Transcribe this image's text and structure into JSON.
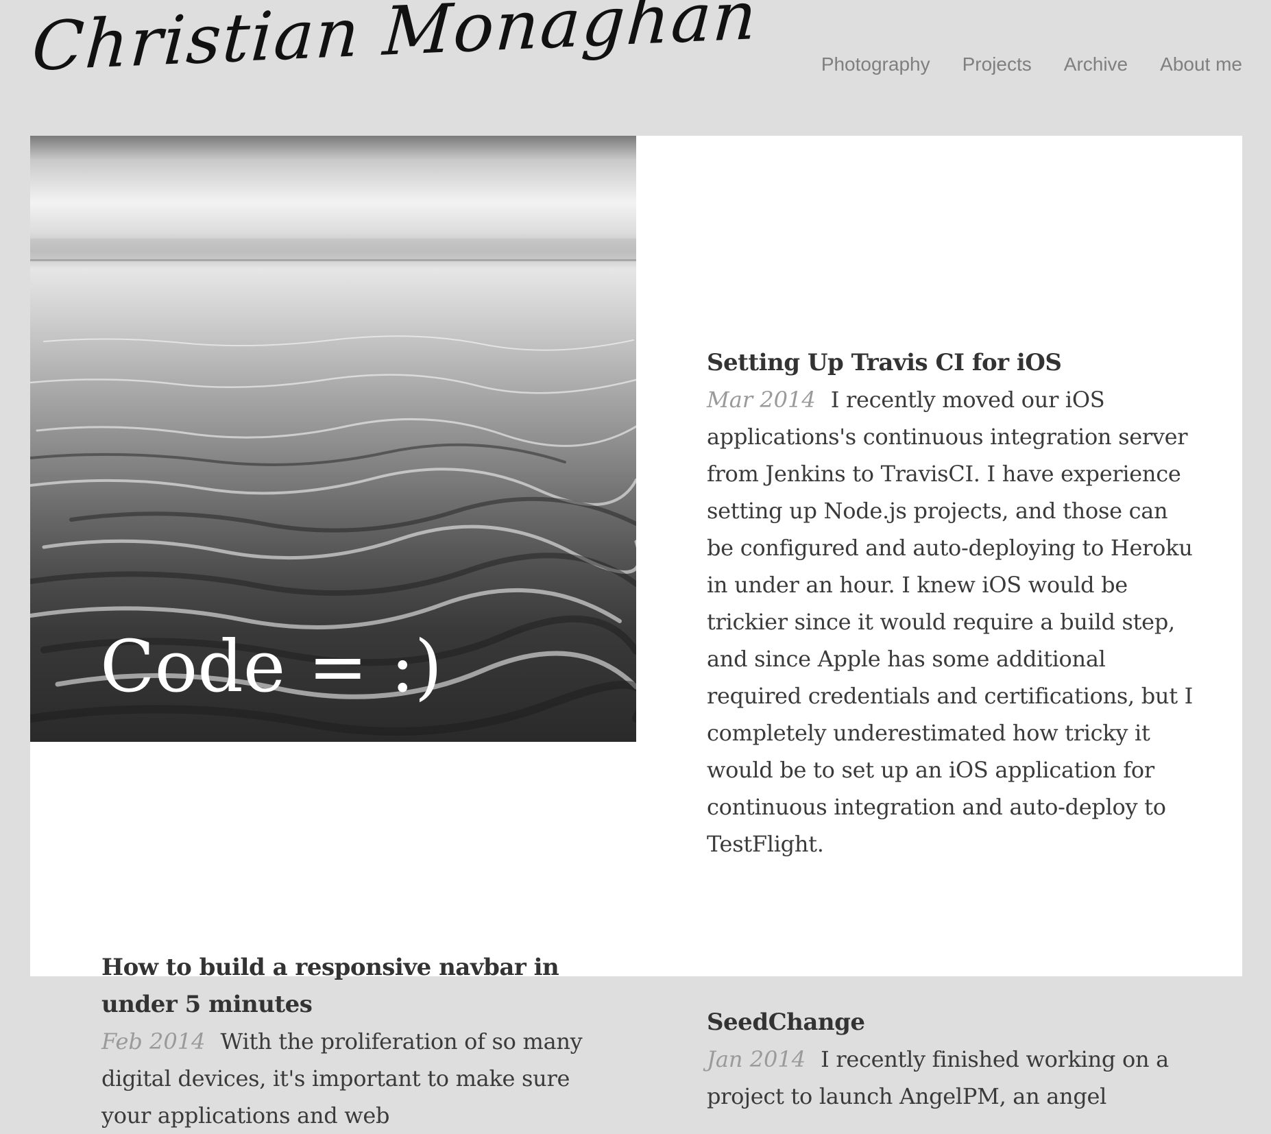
{
  "site": {
    "logo_text": "Christian Monaghan"
  },
  "nav": {
    "items": [
      {
        "label": "Photography"
      },
      {
        "label": "Projects"
      },
      {
        "label": "Archive"
      },
      {
        "label": "About me"
      }
    ]
  },
  "hero": {
    "caption": "Code = :)"
  },
  "posts": [
    {
      "title": "Setting Up Travis CI for iOS",
      "date": "Mar 2014",
      "excerpt": "I recently moved our iOS applications's continuous integration server from Jenkins to TravisCI. I have experience setting up Node.js projects, and those can be configured and auto-deploying to Heroku in under an hour. I knew iOS would be trickier since it would require a build step, and since Apple has some additional required credentials and certifications, but I completely underestimated how tricky it would be to set up an iOS application for continuous integration and auto-deploy to TestFlight."
    },
    {
      "title": "How to build a responsive navbar in under 5 minutes",
      "date": "Feb 2014",
      "excerpt": "With the proliferation of so many digital devices, it's important to make sure your applications and web"
    },
    {
      "title": "SeedChange",
      "date": "Jan 2014",
      "excerpt": "I recently finished working on a project to launch AngelPM, an angel"
    }
  ]
}
